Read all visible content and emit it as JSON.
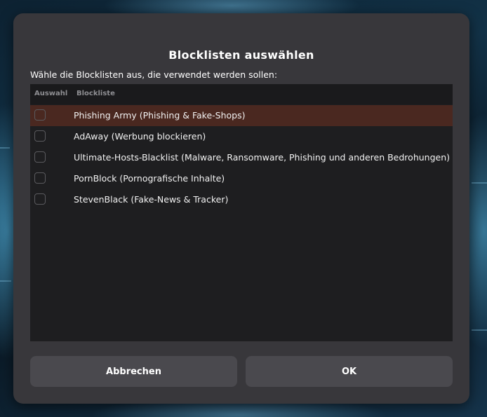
{
  "dialog": {
    "title": "Blocklisten auswählen",
    "instruction": "Wähle die Blocklisten aus, die verwendet werden sollen:"
  },
  "list": {
    "columns": {
      "select": "Auswahl",
      "name": "Blockliste"
    },
    "items": [
      {
        "label": "Phishing Army (Phishing & Fake-Shops)",
        "checked": false,
        "highlighted": true
      },
      {
        "label": "AdAway (Werbung blockieren)",
        "checked": false,
        "highlighted": false
      },
      {
        "label": "Ultimate-Hosts-Blacklist (Malware, Ransomware, Phishing und anderen Bedrohungen)",
        "checked": false,
        "highlighted": false
      },
      {
        "label": "PornBlock (Pornografische Inhalte)",
        "checked": false,
        "highlighted": false
      },
      {
        "label": "StevenBlack (Fake-News & Tracker)",
        "checked": false,
        "highlighted": false
      }
    ]
  },
  "buttons": {
    "cancel": "Abbrechen",
    "ok": "OK"
  },
  "colors": {
    "dialog_bg": "#38373b",
    "list_bg": "#1e1e20",
    "highlight_row": "#4a2820",
    "button_bg": "#4a494e"
  }
}
